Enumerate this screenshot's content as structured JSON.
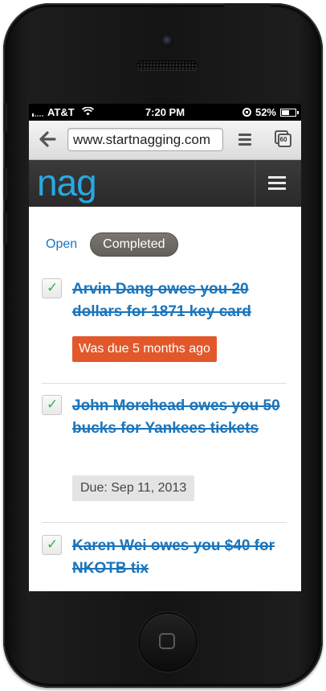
{
  "status_bar": {
    "carrier": "AT&T",
    "time": "7:20 PM",
    "battery": "52%"
  },
  "browser": {
    "url": "www.startnagging.com",
    "tab_count": "60"
  },
  "app": {
    "logo": "nag"
  },
  "filters": {
    "open_label": "Open",
    "completed_label": "Completed",
    "selected": "Completed"
  },
  "nags": [
    {
      "title": "Arvin Dang owes you 20 dollars for 1871 key card",
      "status": "Was due 5 months ago",
      "completed": true
    },
    {
      "title": "John Morehead owes you 50 bucks for Yankees tickets",
      "status": "Due: Sep 11, 2013",
      "completed": true
    },
    {
      "title": "Karen Wei owes you $40 for NKOTB tix",
      "completed": true
    }
  ],
  "colors": {
    "accent": "#1b75bb",
    "logo": "#27a9e1",
    "overdue": "#e2582b",
    "check": "#2fb34a",
    "header_bg": "#2f2f2f"
  }
}
